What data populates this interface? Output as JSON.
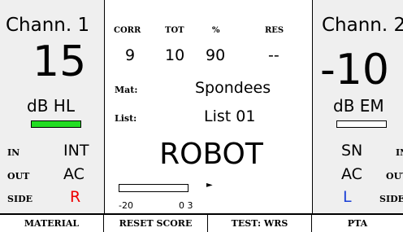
{
  "channel1": {
    "title": "Chann. 1",
    "level": "15",
    "unit": "dB HL",
    "bar_color": "#22dd22",
    "bar_filled": true,
    "rows": [
      {
        "label": "IN",
        "value": "INT"
      },
      {
        "label": "OUT",
        "value": "AC"
      },
      {
        "label": "SIDE",
        "value": "R",
        "color": "#ee0000"
      }
    ]
  },
  "center": {
    "headers": [
      "CORR",
      "TOT",
      "%",
      "RES"
    ],
    "values": [
      "9",
      "10",
      "90",
      "--"
    ],
    "material_label": "Mat:",
    "material_value": "Spondees",
    "list_label": "List:",
    "list_value": "List 01",
    "word": "ROBOT",
    "vu_min_label": "-20",
    "vu_max_label": "0 3",
    "vu_arrow": "►"
  },
  "channel2": {
    "title": "Chann. 2",
    "level": "-10",
    "unit": "dB EM",
    "bar_filled": false,
    "rows": [
      {
        "label": "IN",
        "value": "SN"
      },
      {
        "label": "OUT",
        "value": "AC"
      },
      {
        "label": "SIDE",
        "value": "L",
        "color": "#1a3fd6"
      }
    ]
  },
  "softkeys": [
    {
      "label": "MATERIAL"
    },
    {
      "label": "RESET SCORE"
    },
    {
      "label": "TEST: WRS"
    },
    {
      "label": "PTA"
    }
  ]
}
